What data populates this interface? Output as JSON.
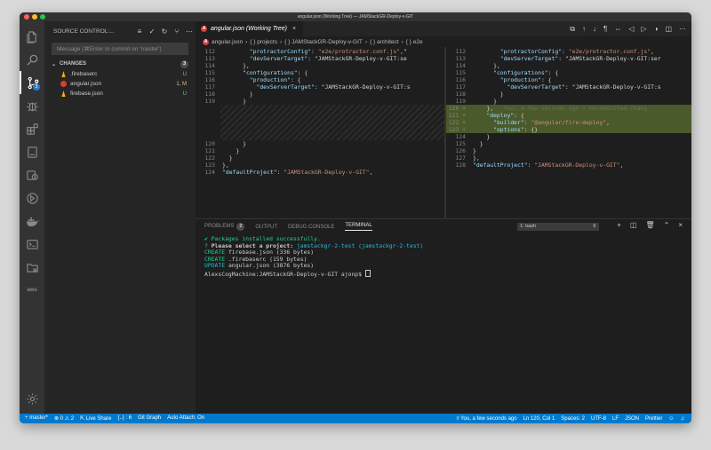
{
  "window": {
    "title": "angular.json (Working Tree) — JAMStackGR-Deploy-v-GIT",
    "traffic_colors": [
      "#ff5f57",
      "#febc2e",
      "#28c840"
    ]
  },
  "activity_bar": {
    "scm_badge": "3",
    "aws_label": "aws"
  },
  "sidebar": {
    "title": "SOURCE CONTROL:...",
    "commit_placeholder": "Message (⌘Enter to commit on 'master')",
    "changes_label": "CHANGES",
    "changes_count": "3",
    "files": [
      {
        "name": ".firebaserc",
        "status": "U",
        "status_color": "#73c991",
        "icon": "firebase-icon"
      },
      {
        "name": "angular.json",
        "status": "1, M",
        "status_color": "#e2c08d",
        "icon": "angular-icon"
      },
      {
        "name": "firebase.json",
        "status": "U",
        "status_color": "#73c991",
        "icon": "firebase-icon"
      }
    ]
  },
  "editor": {
    "tab_title": "angular.json (Working Tree)",
    "tab_close": "×",
    "breadcrumbs": [
      "angular.json",
      "{ } projects",
      "{ } JAMStackGR-Deploy-v-GIT",
      "{ } architect",
      "{ } e2e"
    ],
    "left_lines": [
      {
        "n": "112",
        "code": "        \"protractorConfig\": \"e2e/protractor.conf.js\",\""
      },
      {
        "n": "113",
        "code": "        \"devServerTarget\": \"JAMStackGR-Deploy-v-GIT:se"
      },
      {
        "n": "114",
        "code": "      },"
      },
      {
        "n": "115",
        "code": "      \"configurations\": {"
      },
      {
        "n": "116",
        "code": "        \"production\": {"
      },
      {
        "n": "117",
        "code": "          \"devServerTarget\": \"JAMStackGR-Deploy-v-GIT:s"
      },
      {
        "n": "118",
        "code": "        }"
      },
      {
        "n": "119",
        "code": "      }"
      }
    ],
    "left_lines_after": [
      {
        "n": "120",
        "code": "      }"
      },
      {
        "n": "121",
        "code": "    }"
      },
      {
        "n": "122",
        "code": "  }"
      },
      {
        "n": "123",
        "code": "},"
      },
      {
        "n": "124",
        "code": "\"defaultProject\": \"JAMStackGR-Deploy-v-GIT\","
      }
    ],
    "right_lines": [
      {
        "n": "112",
        "code": "        \"protractorConfig\": \"e2e/protractor.conf.js\","
      },
      {
        "n": "113",
        "code": "        \"devServerTarget\": \"JAMStackGR-Deploy-v-GIT:ser"
      },
      {
        "n": "114",
        "code": "      },"
      },
      {
        "n": "115",
        "code": "      \"configurations\": {"
      },
      {
        "n": "116",
        "code": "        \"production\": {"
      },
      {
        "n": "117",
        "code": "          \"devServerTarget\": \"JAMStackGR-Deploy-v-GIT:s"
      },
      {
        "n": "118",
        "code": "        }"
      },
      {
        "n": "119",
        "code": "      }"
      },
      {
        "n": "120 +",
        "code": "    },",
        "ghost": "   You, a few seconds ago • Uncommitted chang",
        "added": true
      },
      {
        "n": "121 +",
        "code": "    \"deploy\": {",
        "added": true
      },
      {
        "n": "122 +",
        "code": "      \"builder\": \"@angular/fire:deploy\",",
        "added": true
      },
      {
        "n": "123 +",
        "code": "      \"options\": {}",
        "added": true
      },
      {
        "n": "124",
        "code": "    }"
      },
      {
        "n": "125",
        "code": "  }"
      },
      {
        "n": "126",
        "code": "}"
      },
      {
        "n": "127",
        "code": "},"
      },
      {
        "n": "128",
        "code": "\"defaultProject\": \"JAMStackGR-Deploy-v-GIT\","
      }
    ]
  },
  "panel": {
    "tabs": [
      "PROBLEMS",
      "OUTPUT",
      "DEBUG CONSOLE",
      "TERMINAL"
    ],
    "problems_count": "2",
    "terminal_select": "1: bash",
    "terminal_lines": [
      {
        "parts": [
          {
            "t": "✔ Packages installed successfully.",
            "c": "green"
          }
        ]
      },
      {
        "parts": [
          {
            "t": "? ",
            "c": "green"
          },
          {
            "t": "Please select a project: ",
            "c": "bold"
          },
          {
            "t": "jamstackgr-2-test (jamstackgr-2-test)",
            "c": "cyan"
          }
        ]
      },
      {
        "parts": [
          {
            "t": "CREATE ",
            "c": "green"
          },
          {
            "t": "firebase.json (336 bytes)",
            "c": ""
          }
        ]
      },
      {
        "parts": [
          {
            "t": "CREATE ",
            "c": "green"
          },
          {
            "t": ".firebaserc (159 bytes)",
            "c": ""
          }
        ]
      },
      {
        "parts": [
          {
            "t": "UPDATE ",
            "c": "cyan"
          },
          {
            "t": "angular.json (3876 bytes)",
            "c": ""
          }
        ]
      },
      {
        "parts": [
          {
            "t": "AlexsCogMachine:JAMStackGR-Deploy-v-GIT ajonp$ ",
            "c": ""
          }
        ]
      }
    ]
  },
  "statusbar": {
    "branch": "master*",
    "problems": "⊗ 0 ⚠ 2",
    "live_share": "Live Share",
    "braces": "{..} : 6",
    "git_graph": "Git Graph",
    "auto_attach": "Auto Attach: On",
    "blame": "You, a few seconds ago",
    "position": "Ln 120, Col 1",
    "spaces": "Spaces: 2",
    "encoding": "UTF-8",
    "eol": "LF",
    "language": "JSON",
    "prettier": "Prettier"
  }
}
